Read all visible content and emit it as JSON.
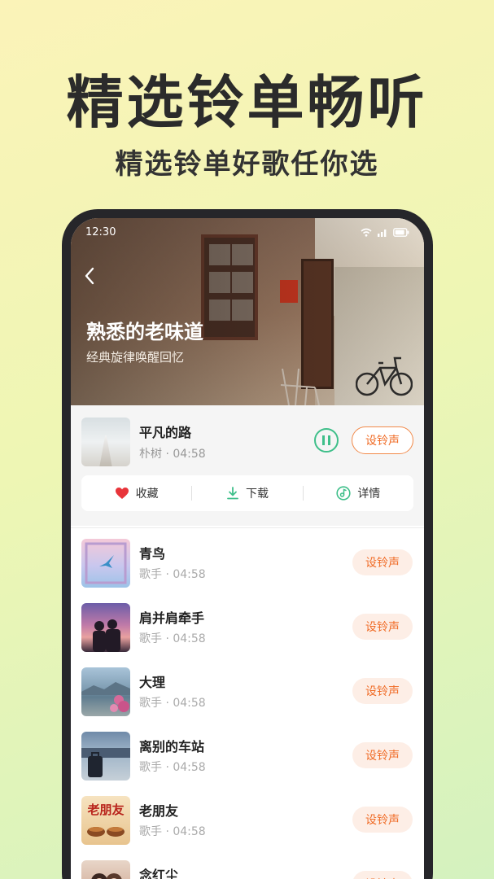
{
  "promo": {
    "headline": "精选铃单畅听",
    "subline": "精选铃单好歌任你选"
  },
  "status_bar": {
    "time": "12:30"
  },
  "playlist": {
    "title": "熟悉的老味道",
    "subtitle": "经典旋律唤醒回忆"
  },
  "now_playing": {
    "title": "平凡的路",
    "meta": "朴树 · 04:58",
    "set_ringtone": "设铃声",
    "actions": {
      "favorite": "收藏",
      "download": "下载",
      "detail": "详情"
    }
  },
  "songs": [
    {
      "title": "青鸟",
      "meta": "歌手 · 04:58",
      "button": "设铃声"
    },
    {
      "title": "肩并肩牵手",
      "meta": "歌手 · 04:58",
      "button": "设铃声"
    },
    {
      "title": "大理",
      "meta": "歌手 · 04:58",
      "button": "设铃声"
    },
    {
      "title": "离别的车站",
      "meta": "歌手 · 04:58",
      "button": "设铃声"
    },
    {
      "title": "老朋友",
      "meta": "歌手 · 04:58",
      "button": "设铃声",
      "cover_text": "老朋友"
    },
    {
      "title": "念红尘",
      "meta": "",
      "button": "设铃声"
    }
  ],
  "colors": {
    "accent": "#f06b25",
    "play_green": "#3fbf8a",
    "heart_red": "#e8343a"
  }
}
